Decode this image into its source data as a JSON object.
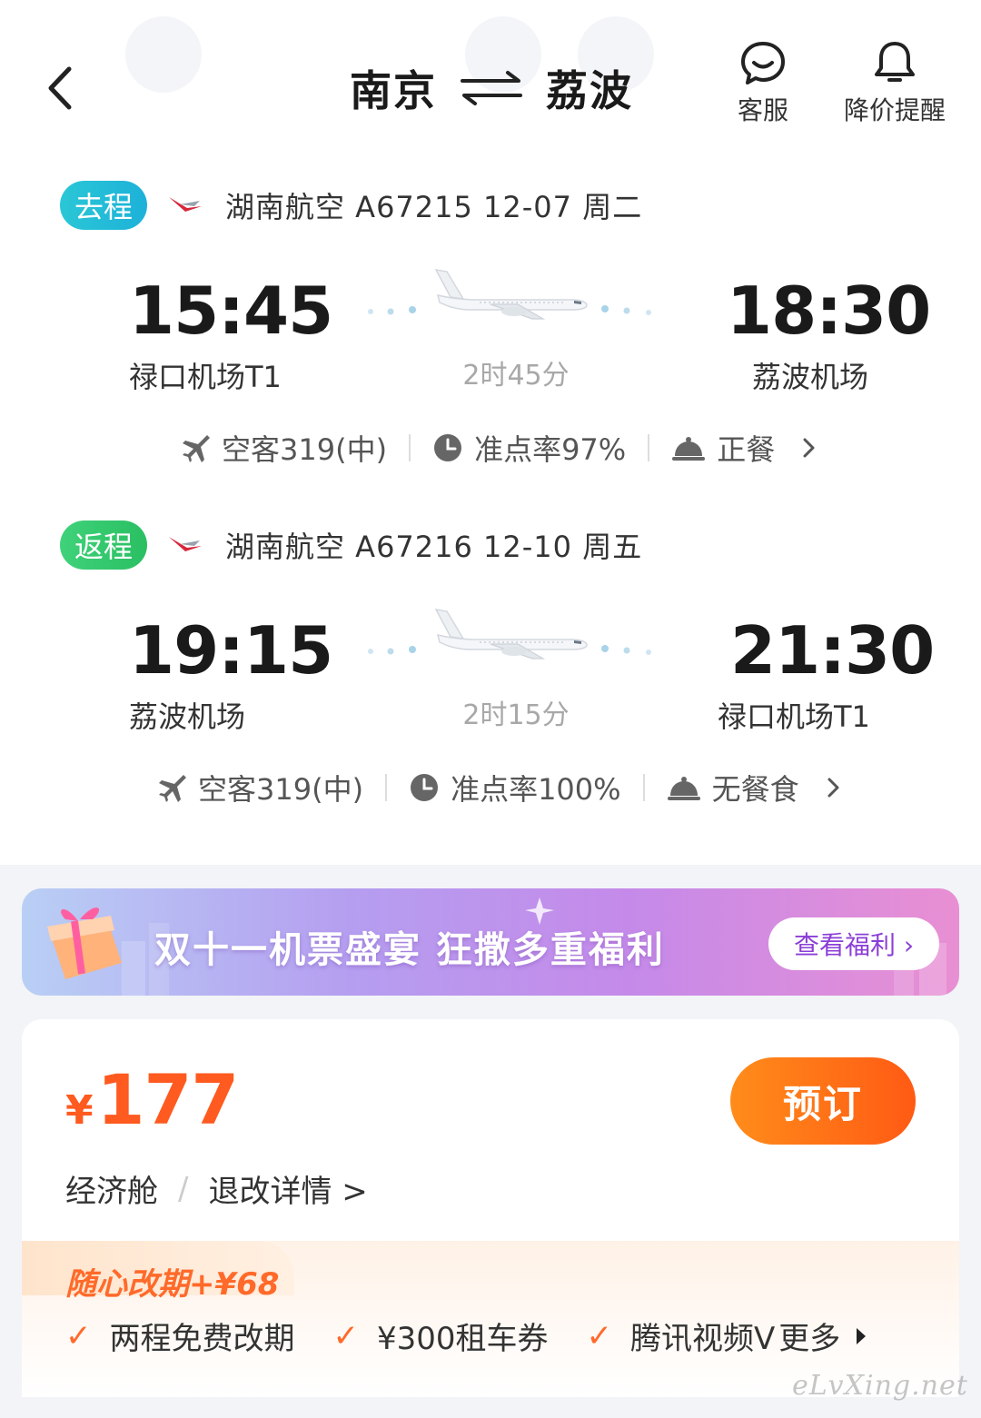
{
  "header": {
    "from_city": "南京",
    "to_city": "荔波",
    "service_label": "客服",
    "price_alert_label": "降价提醒"
  },
  "legs": [
    {
      "tag": "去程",
      "info": "湖南航空 A67215  12-07 周二",
      "depart_time": "15:45",
      "depart_airport": "禄口机场T1",
      "duration": "2时45分",
      "arrive_time": "18:30",
      "arrive_airport": "荔波机场",
      "aircraft": "空客319(中)",
      "on_time": "准点率97%",
      "meal": "正餐"
    },
    {
      "tag": "返程",
      "info": "湖南航空 A67216  12-10 周五",
      "depart_time": "19:15",
      "depart_airport": "荔波机场",
      "duration": "2时15分",
      "arrive_time": "21:30",
      "arrive_airport": "禄口机场T1",
      "aircraft": "空客319(中)",
      "on_time": "准点率100%",
      "meal": "无餐食"
    }
  ],
  "banner": {
    "text": "双十一机票盛宴 狂撒多重福利",
    "button": "查看福利 ›"
  },
  "fare": {
    "currency": "¥",
    "price": "177",
    "book_label": "预订",
    "cabin": "经济舱",
    "refund_rules": "退改详情 >"
  },
  "promo": {
    "title": "随心改期+¥68",
    "benefits": [
      "两程免费改期",
      "¥300租车券",
      "腾讯视频V"
    ],
    "more_label": "更多"
  },
  "watermark": "eLvXing.net",
  "colors": {
    "accent_orange": "#ff5a1f",
    "tag_go": "#1db1d9",
    "tag_return": "#2abf62",
    "banner_purple": "#b59ef0"
  }
}
